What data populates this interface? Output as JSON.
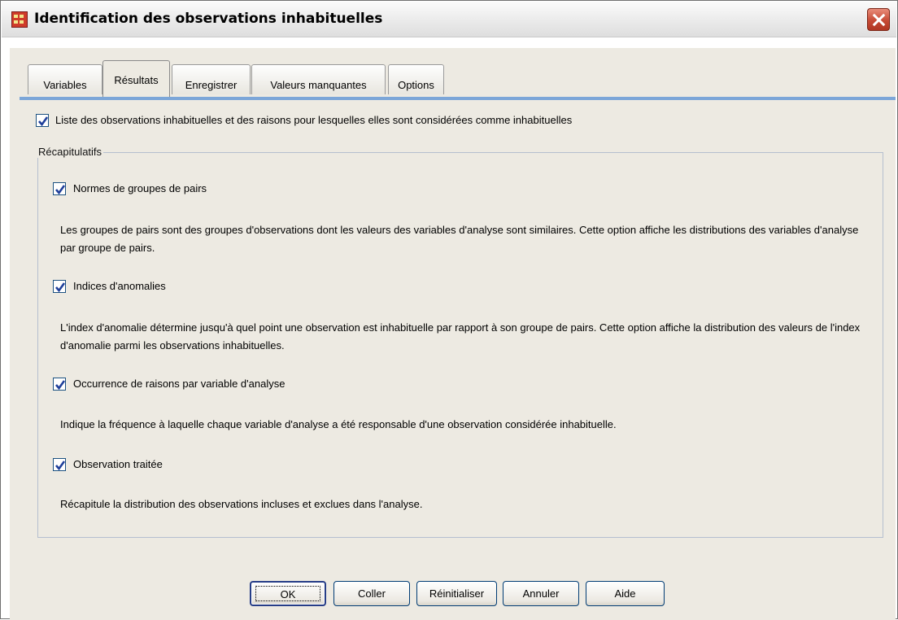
{
  "window": {
    "title": "Identification des observations inhabituelles",
    "close_label": "×"
  },
  "tabs": [
    {
      "label": "Variables",
      "active": false
    },
    {
      "label": "Résultats",
      "active": true
    },
    {
      "label": "Enregistrer",
      "active": false
    },
    {
      "label": "Valeurs manquantes",
      "active": false
    },
    {
      "label": "Options",
      "active": false
    }
  ],
  "main": {
    "list_checkbox": {
      "checked": true,
      "label": "Liste des observations inhabituelles et des raisons pour lesquelles elles sont considérées comme inhabituelles"
    },
    "summaries": {
      "group_title": "Récapitulatifs",
      "items": [
        {
          "label": "Normes de groupes de pairs",
          "checked": true,
          "description": "Les groupes de pairs sont des groupes d'observations dont les valeurs des variables d'analyse sont similaires. Cette option affiche les distributions des variables d'analyse par groupe de pairs."
        },
        {
          "label": "Indices d'anomalies",
          "checked": true,
          "description": "L'index d'anomalie détermine jusqu'à quel point une observation est inhabituelle par rapport à son groupe de pairs. Cette option affiche la distribution des valeurs de l'index d'anomalie parmi les observations inhabituelles."
        },
        {
          "label": "Occurrence de raisons par variable d'analyse",
          "checked": true,
          "description": "Indique la fréquence à laquelle chaque variable d'analyse a été responsable d'une observation considérée inhabituelle."
        },
        {
          "label": "Observation traitée",
          "checked": true,
          "description": "Récapitule la distribution des observations incluses et exclues dans l'analyse."
        }
      ]
    }
  },
  "buttons": {
    "ok": "OK",
    "paste": "Coller",
    "reset": "Réinitialiser",
    "cancel": "Annuler",
    "help": "Aide"
  },
  "colors": {
    "panel": "#edeae2",
    "tab_accent": "#7ca6d8",
    "close_button": "#c64a35",
    "check_mark": "#1f3f9a"
  }
}
